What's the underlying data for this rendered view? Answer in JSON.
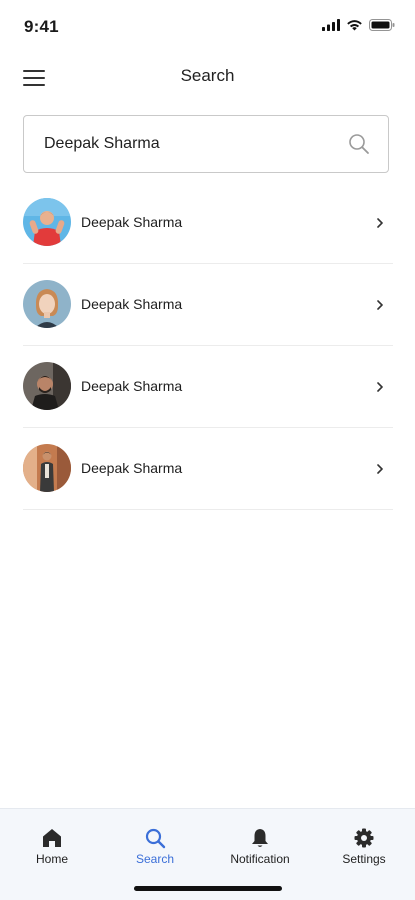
{
  "status_bar": {
    "time": "9:41",
    "icons": [
      "cellular-signal-icon",
      "wifi-icon",
      "battery-icon"
    ]
  },
  "header": {
    "title": "Search",
    "menu_icon": "hamburger-menu-icon"
  },
  "search": {
    "value": "Deepak Sharma",
    "icon": "search-icon"
  },
  "results": [
    {
      "name": "Deepak Sharma",
      "avatar": "avatar-photo-man-red-shirt"
    },
    {
      "name": "Deepak Sharma",
      "avatar": "avatar-photo-woman"
    },
    {
      "name": "Deepak Sharma",
      "avatar": "avatar-photo-man-dark"
    },
    {
      "name": "Deepak Sharma",
      "avatar": "avatar-photo-man-standing"
    }
  ],
  "tabs": [
    {
      "label": "Home",
      "icon": "home-icon",
      "active": false
    },
    {
      "label": "Search",
      "icon": "search-icon",
      "active": true
    },
    {
      "label": "Notification",
      "icon": "bell-icon",
      "active": false
    },
    {
      "label": "Settings",
      "icon": "gear-icon",
      "active": false
    }
  ],
  "colors": {
    "accent": "#3b6fd8",
    "tab_bar_bg": "#f4f7fb",
    "divider": "#ececec",
    "text": "#1e1e1e"
  }
}
